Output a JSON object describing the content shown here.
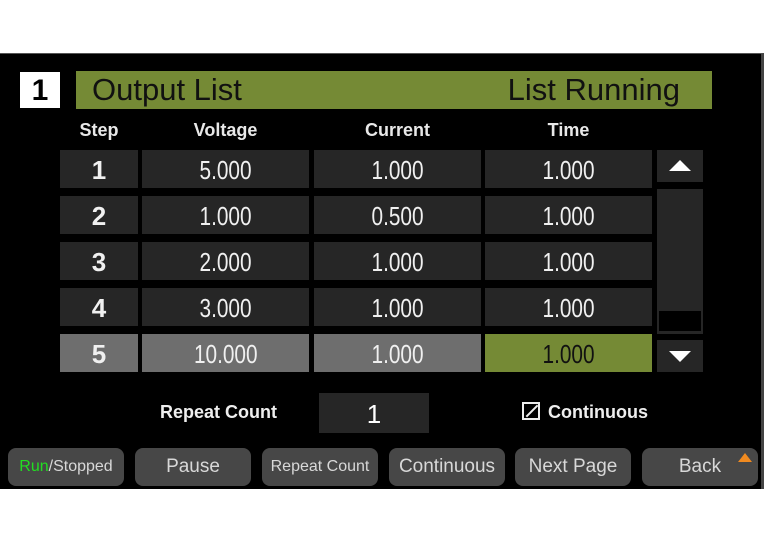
{
  "header": {
    "channel": "1",
    "title": "Output List",
    "status": "List Running"
  },
  "columns": [
    "Step",
    "Voltage",
    "Current",
    "Time"
  ],
  "rows": [
    {
      "step": "1",
      "voltage": "5.000",
      "current": "1.000",
      "time": "1.000"
    },
    {
      "step": "2",
      "voltage": "1.000",
      "current": "0.500",
      "time": "1.000"
    },
    {
      "step": "3",
      "voltage": "2.000",
      "current": "1.000",
      "time": "1.000"
    },
    {
      "step": "4",
      "voltage": "3.000",
      "current": "1.000",
      "time": "1.000"
    },
    {
      "step": "5",
      "voltage": "10.000",
      "current": "1.000",
      "time": "1.000"
    }
  ],
  "selected_row": 5,
  "editing_field": "time",
  "scroll": {
    "up_icon": "triangle-up",
    "down_icon": "triangle-down",
    "position": "bottom"
  },
  "repeat": {
    "label": "Repeat Count",
    "value": "1"
  },
  "continuous": {
    "label": "Continuous",
    "checked": true,
    "icon": "checkbox-checked"
  },
  "softkeys": {
    "run_on": "Run",
    "run_sep": "/Stopped",
    "pause": "Pause",
    "repeat_count": "Repeat Count",
    "continuous": "Continuous",
    "next_page": "Next Page",
    "back": "Back"
  },
  "colors": {
    "accent_green": "#758a35",
    "run_green": "#22dd22",
    "corner_orange": "#f08a20"
  }
}
